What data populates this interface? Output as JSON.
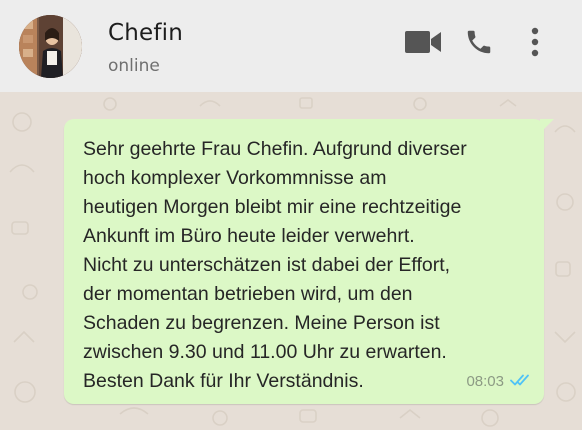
{
  "header": {
    "contact_name": "Chefin",
    "status": "online",
    "icons": [
      "video-call-icon",
      "phone-icon",
      "more-vertical-icon"
    ]
  },
  "message": {
    "text": "Sehr geehrte Frau Chefin. Aufgrund diverser\nhoch komplexer Vorkommnisse am\nheutigen Morgen bleibt mir eine rechtzeitige\nAnkunft im Büro heute leider verwehrt.\nNicht zu unterschätzen ist dabei der Effort,\nder momentan betrieben wird, um den\nSchaden zu begrenzen. Meine Person ist\nzwischen 9.30 und 11.00 Uhr zu erwarten.\nBesten Dank für Ihr Verständnis.",
    "time": "08:03",
    "status_icon": "double-check-read-icon"
  },
  "colors": {
    "header_bg": "#ededed",
    "chat_bg": "#e6ded6",
    "bubble_bg": "#dcf8c6",
    "read_tick": "#4fc3f7",
    "icon_gray": "#555555"
  }
}
